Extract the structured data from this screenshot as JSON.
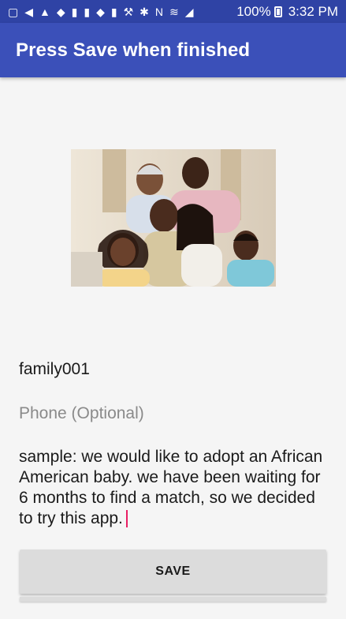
{
  "status_bar": {
    "left_icons": [
      "message-icon",
      "send-icon",
      "alert-icon",
      "shield-icon",
      "bottle-icon",
      "bottle-icon",
      "shield-icon",
      "bottle-icon",
      "wrench-icon",
      "bluetooth-icon",
      "nfc-icon",
      "wifi-icon",
      "signal-icon"
    ],
    "battery": "100%",
    "time": "3:32 PM"
  },
  "app_bar": {
    "title": "Press Save when finished"
  },
  "form": {
    "name_value": "family001",
    "phone_placeholder": "Phone (Optional)",
    "description_value": "sample:  we would like to adopt an African American baby.  we have been waiting for 6 months to find a match, so we decided to try this app."
  },
  "save_button": {
    "label": "SAVE"
  },
  "colors": {
    "status_bar": "#2f43a5",
    "app_bar": "#3b50b9",
    "cursor": "#e91e63",
    "button_bg": "#dcdcdc"
  }
}
